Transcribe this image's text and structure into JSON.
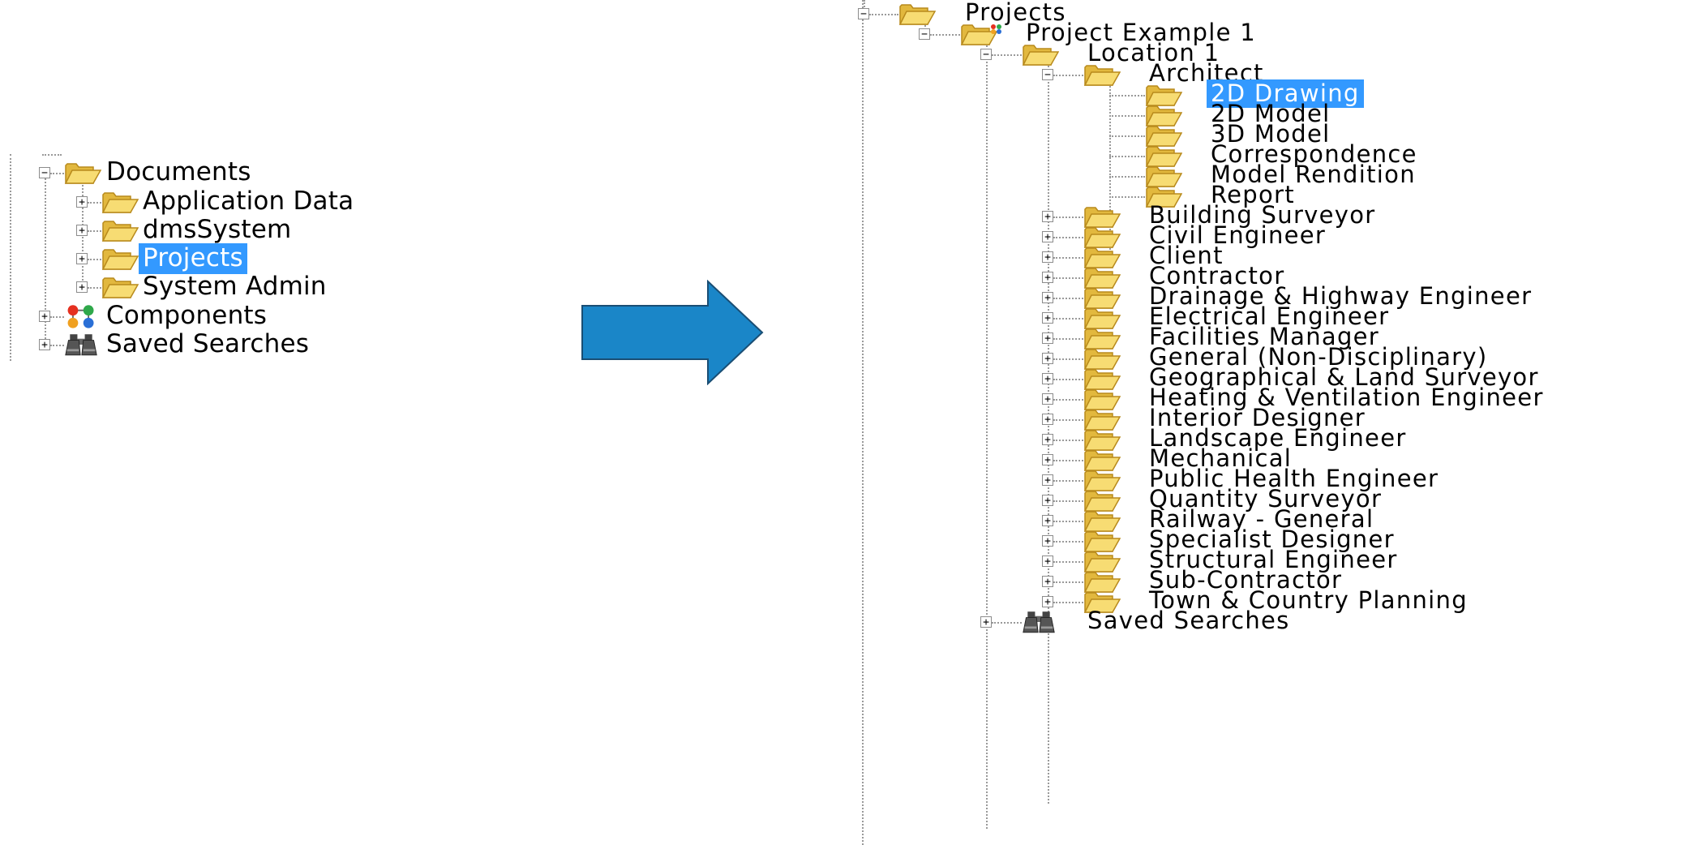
{
  "left_tree": {
    "items": [
      {
        "label": "Documents",
        "icon": "folder-open-icon",
        "expander": "minus"
      },
      {
        "label": "Application Data",
        "icon": "folder-icon",
        "expander": "plus"
      },
      {
        "label": "dmsSystem",
        "icon": "folder-icon",
        "expander": "plus"
      },
      {
        "label": "Projects",
        "icon": "folder-icon",
        "expander": "plus",
        "selected": true
      },
      {
        "label": "System Admin",
        "icon": "folder-icon",
        "expander": "plus"
      },
      {
        "label": "Components",
        "icon": "components-icon",
        "expander": "plus"
      },
      {
        "label": "Saved Searches",
        "icon": "binoculars-icon",
        "expander": "plus"
      }
    ]
  },
  "arrow": {
    "color": "#1a86c8",
    "border": "#1a4e74"
  },
  "right_tree": {
    "root": {
      "label": "Projects"
    },
    "project": {
      "label": "Project Example 1"
    },
    "location": {
      "label": "Location 1"
    },
    "architect": {
      "label": "Architect"
    },
    "architect_children": [
      {
        "label": "2D Drawing",
        "selected": true
      },
      {
        "label": "2D Model"
      },
      {
        "label": "3D Model"
      },
      {
        "label": "Correspondence"
      },
      {
        "label": "Model Rendition"
      },
      {
        "label": "Report"
      }
    ],
    "disciplines": [
      "Building Surveyor",
      "Civil Engineer",
      "Client",
      "Contractor",
      "Drainage & Highway Engineer",
      "Electrical Engineer",
      "Facilities Manager",
      "General (Non-Disciplinary)",
      "Geographical & Land Surveyor",
      "Heating & Ventilation Engineer",
      "Interior Designer",
      "Landscape Engineer",
      "Mechanical",
      "Public Health Engineer",
      "Quantity Surveyor",
      "Railway - General",
      "Specialist Designer",
      "Structural Engineer",
      "Sub-Contractor",
      "Town & Country Planning"
    ],
    "saved_searches": {
      "label": "Saved Searches"
    }
  },
  "colors": {
    "selection": "#3399ff",
    "folder": "#f2d35b",
    "folder_edge": "#b88a1c"
  }
}
